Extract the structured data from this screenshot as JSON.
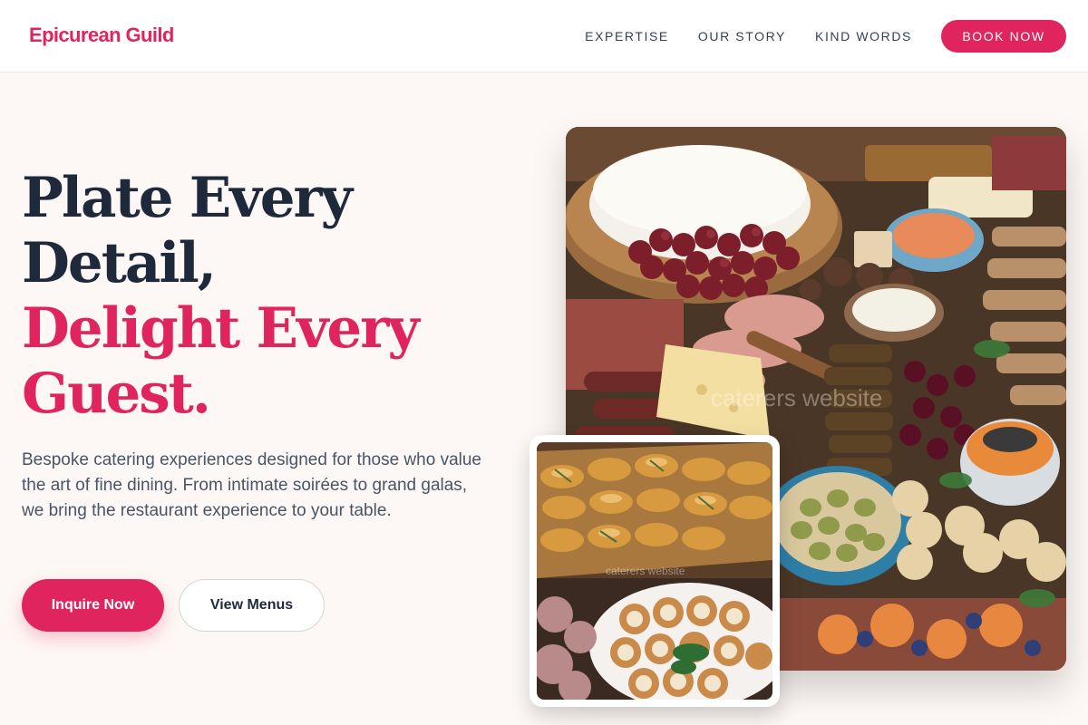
{
  "header": {
    "logo": "Epicurean Guild",
    "nav": [
      "EXPERTISE",
      "OUR STORY",
      "KIND WORDS"
    ],
    "cta": "BOOK NOW"
  },
  "hero": {
    "title_lines": [
      "Plate Every",
      "Detail,",
      "Delight Every",
      "Guest."
    ],
    "description": "Bespoke catering experiences designed for those who value the art of fine dining. From intimate soirées to grand galas, we bring the restaurant experience to your table.",
    "primary_button": "Inquire Now",
    "secondary_button": "View Menus"
  },
  "images": {
    "main": {
      "subject": "charcuterie grazing board",
      "watermark": "caterers website"
    },
    "secondary": {
      "subject": "croissants and tartlets platter",
      "watermark": "caterers website"
    }
  },
  "colors": {
    "accent": "#e0245e",
    "heading": "#1e293b",
    "text": "#475569",
    "background": "#fdf8f5"
  }
}
